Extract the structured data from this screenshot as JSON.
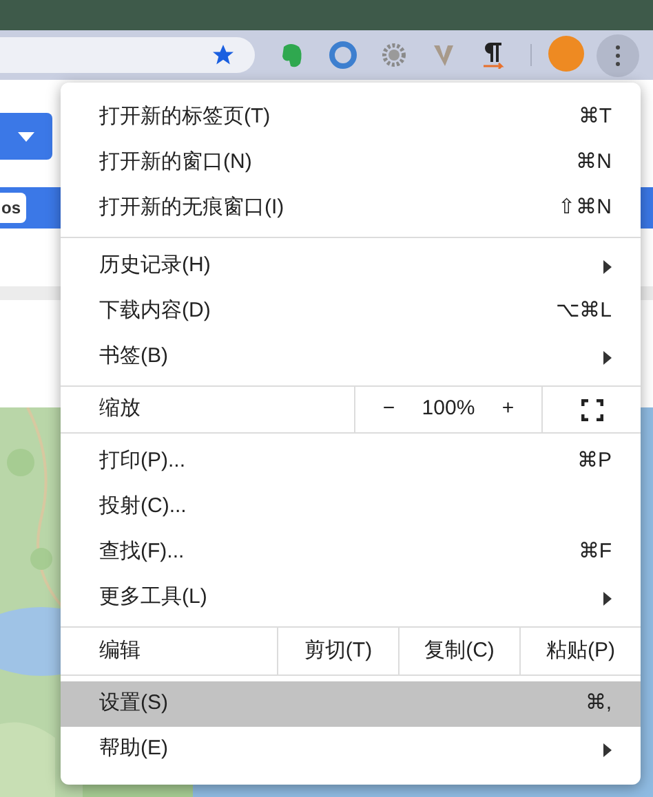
{
  "page": {
    "chip_label": "os"
  },
  "menu": {
    "groups": [
      {
        "items": [
          {
            "kind": "command",
            "label": "打开新的标签页(T)",
            "shortcut": "⌘T",
            "has_submenu": false,
            "selected": false
          },
          {
            "kind": "command",
            "label": "打开新的窗口(N)",
            "shortcut": "⌘N",
            "has_submenu": false,
            "selected": false
          },
          {
            "kind": "command",
            "label": "打开新的无痕窗口(I)",
            "shortcut": "⇧⌘N",
            "has_submenu": false,
            "selected": false
          }
        ]
      },
      {
        "items": [
          {
            "kind": "command",
            "label": "历史记录(H)",
            "has_submenu": true,
            "selected": false
          },
          {
            "kind": "command",
            "label": "下载内容(D)",
            "shortcut": "⌥⌘L",
            "has_submenu": false,
            "selected": false
          },
          {
            "kind": "command",
            "label": "书签(B)",
            "has_submenu": true,
            "selected": false
          }
        ]
      },
      {
        "items": [
          {
            "kind": "zoom",
            "label": "缩放",
            "minus": "−",
            "value": "100%",
            "plus": "+"
          }
        ]
      },
      {
        "items": [
          {
            "kind": "command",
            "label": "打印(P)...",
            "shortcut": "⌘P",
            "has_submenu": false,
            "selected": false
          },
          {
            "kind": "command",
            "label": "投射(C)...",
            "has_submenu": false,
            "selected": false
          },
          {
            "kind": "command",
            "label": "查找(F)...",
            "shortcut": "⌘F",
            "has_submenu": false,
            "selected": false
          },
          {
            "kind": "command",
            "label": "更多工具(L)",
            "has_submenu": true,
            "selected": false
          }
        ]
      },
      {
        "items": [
          {
            "kind": "edit",
            "label": "编辑",
            "buttons": [
              "剪切(T)",
              "复制(C)",
              "粘贴(P)"
            ]
          }
        ]
      },
      {
        "items": [
          {
            "kind": "command",
            "label": "设置(S)",
            "shortcut": "⌘,",
            "has_submenu": false,
            "selected": true
          },
          {
            "kind": "command",
            "label": "帮助(E)",
            "has_submenu": true,
            "selected": false
          }
        ]
      }
    ]
  }
}
